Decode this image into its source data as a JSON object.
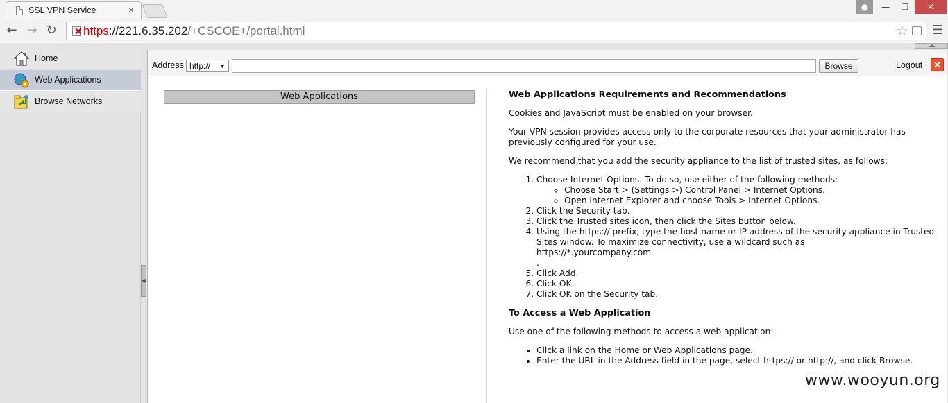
{
  "browser": {
    "tab_title": "SSL VPN Service",
    "tab_close": "×",
    "url_scheme": "https",
    "url_host": "://221.6.35.202",
    "url_path": "/+CSCOE+/portal.html"
  },
  "nav": {
    "items": [
      {
        "label": "Home",
        "icon": "house-icon"
      },
      {
        "label": "Web Applications",
        "icon": "globe-gear-icon",
        "selected": true
      },
      {
        "label": "Browse Networks",
        "icon": "folder-network-icon"
      }
    ]
  },
  "address_bar": {
    "label": "Address",
    "protocol": "http://",
    "url_value": "",
    "browse_label": "Browse",
    "logout_label": "Logout"
  },
  "panel": {
    "header": "Web Applications"
  },
  "help": {
    "heading1": "Web Applications Requirements and Recommendations",
    "p1": "Cookies and JavaScript must be enabled on your browser.",
    "p2": "Your VPN session provides access only to the corporate resources that your administrator has previously configured for your use.",
    "p3": "We recommend that you add the security appliance to the list of trusted sites, as follows:",
    "steps": [
      "Choose Internet Options. To do so, use either of the following methods:",
      "Click the Security tab.",
      "Click the Trusted sites icon, then click the Sites button below.",
      "Using the https:// prefix, type the host name or IP address of the security appliance in Trusted Sites window. To maximize connectivity, use a wildcard such as",
      "Click Add.",
      "Click OK.",
      "Click OK on the Security tab."
    ],
    "step1_sub": [
      "Choose Start > (Settings >) Control Panel > Internet Options.",
      "Open Internet Explorer and choose Tools > Internet Options."
    ],
    "step4_example": "https://*.yourcompany.com",
    "step4_dot": ".",
    "heading2": "To Access a Web Application",
    "p4": "Use one of the following methods to access a web application:",
    "methods": [
      "Click a link on the Home or Web Applications page.",
      "Enter the URL in the Address field in the page, select https:// or http://, and click Browse."
    ]
  },
  "watermark": "www.wooyun.org"
}
